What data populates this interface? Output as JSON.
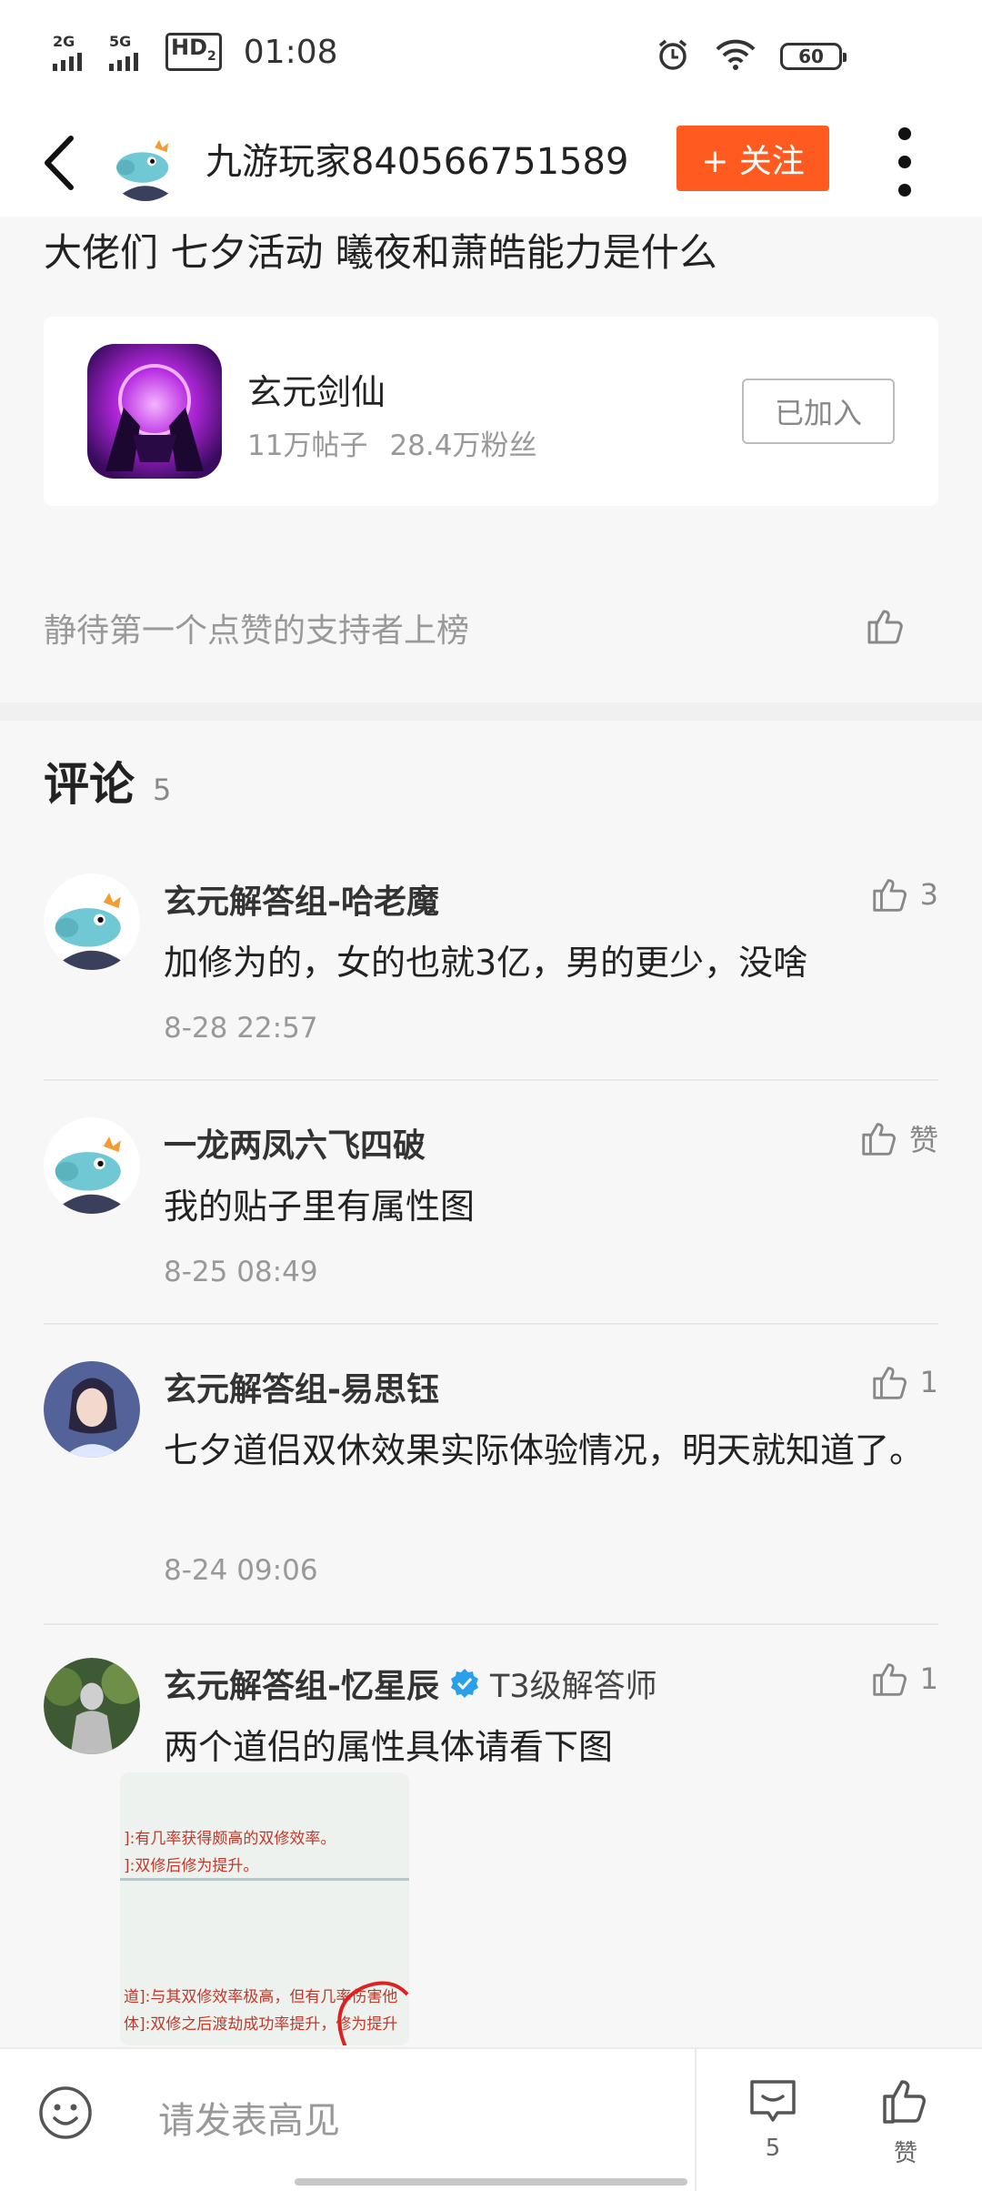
{
  "status_bar": {
    "time": "01:08",
    "signal_1": "2G",
    "signal_2": "5G",
    "hd": "HD",
    "hd_sub": "2",
    "battery": "60"
  },
  "header": {
    "author_name": "九游玩家840566751589",
    "follow_label": "+ 关注"
  },
  "post": {
    "title": "大佬们 七夕活动 曦夜和萧皓能力是什么"
  },
  "forum": {
    "name": "玄元剑仙",
    "posts": "11万帖子",
    "fans": "28.4万粉丝",
    "joined_label": "已加入"
  },
  "supporter": {
    "text": "静待第一个点赞的支持者上榜"
  },
  "comments_section": {
    "title": "评论",
    "count": "5"
  },
  "comments": [
    {
      "name": "玄元解答组-哈老魔",
      "text": "加修为的，女的也就3亿，男的更少，没啥",
      "time": "8-28 22:57",
      "likes": "3"
    },
    {
      "name": "一龙两凤六飞四破",
      "text": "我的贴子里有属性图",
      "time": "8-25 08:49",
      "likes": "赞"
    },
    {
      "name": "玄元解答组-易思钰",
      "text": "七夕道侣双休效果实际体验情况，明天就知道了。",
      "time": "8-24 09:06",
      "likes": "1"
    },
    {
      "name": "玄元解答组-忆星辰",
      "title_tag": "T3级解答师",
      "text": "两个道侣的属性具体请看下图",
      "likes": "1"
    }
  ],
  "comment_image_lines": [
    "]:有几率获得颇高的双修效率。",
    "]:双修后修为提升。",
    "道]:与其双修效率极高，但有几率伤害他",
    "体]:双修之后渡劫成功率提升，修为提升"
  ],
  "bottom_bar": {
    "input_placeholder": "请发表高见",
    "comment_count": "5",
    "like_label": "赞"
  }
}
